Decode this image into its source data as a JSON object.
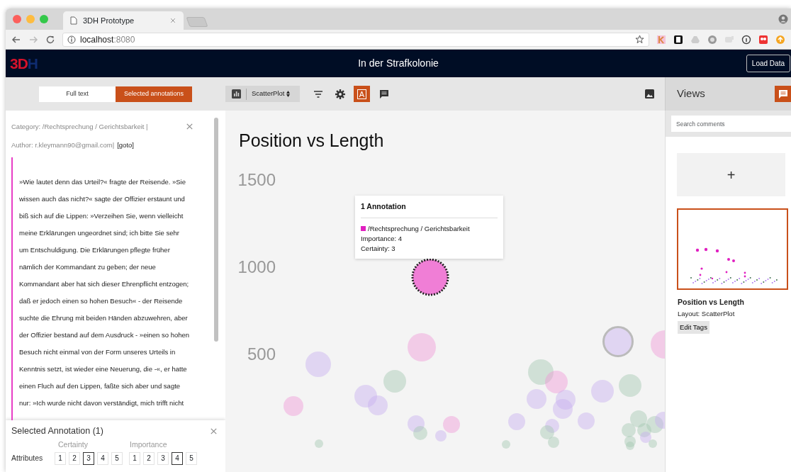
{
  "browser": {
    "tab_title": "3DH Prototype",
    "url_host": "localhost",
    "url_port": ":8080"
  },
  "app": {
    "logo_main": "3D",
    "logo_tail": "H",
    "title": "In der Strafkolonie",
    "load_button": "Load Data"
  },
  "text_modes": [
    {
      "label": "Full text",
      "selected": false
    },
    {
      "label": "Selected annotations",
      "selected": true
    }
  ],
  "toolbar": {
    "layout_select": "ScatterPlot",
    "annotation_toggle": {
      "label": "A",
      "on": true
    }
  },
  "annotation_detail": {
    "category": "Category: /Rechtsprechung / Gerichtsbarkeit |",
    "author": "Author: r.kleymann90@gmail.com|",
    "goto": "[goto]",
    "text_lines": [
      "»Wie lautet denn das Urteil?« fragte der Reisende. »Sie",
      "wissen auch das nicht?« sagte der Offizier erstaunt und",
      "biß sich auf die Lippen: »Verzeihen Sie, wenn vielleicht",
      "meine Erklärungen ungeordnet sind; ich bitte Sie sehr",
      "um Entschuldigung. Die Erklärungen pflegte früher",
      "nämlich der Kommandant zu geben; der neue",
      "Kommandant aber hat sich dieser Ehrenpflicht entzogen;",
      "daß er jedoch einen so hohen Besuch« - der Reisende",
      "suchte die Ehrung mit beiden Händen abzuwehren, aber",
      "der Offizier bestand auf dem Ausdruck - »einen so hohen",
      "Besuch nicht einmal von der Form unseres Urteils in",
      "Kenntnis setzt, ist wieder eine Neuerung, die -«, er hatte",
      "einen Fluch auf den Lippen, faßte sich aber und sagte",
      "nur: »Ich wurde nicht davon verständigt, mich trifft nicht"
    ]
  },
  "selected_annotation": {
    "title": "Selected Annotation (1)",
    "row_label": "Attributes",
    "groups": [
      {
        "name": "Certainty",
        "options": [
          {
            "label": "1",
            "selected": false
          },
          {
            "label": "2",
            "selected": false
          },
          {
            "label": "3",
            "selected": true
          },
          {
            "label": "4",
            "selected": false
          },
          {
            "label": "5",
            "selected": false
          }
        ]
      },
      {
        "name": "Importance",
        "options": [
          {
            "label": "1",
            "selected": false
          },
          {
            "label": "2",
            "selected": false
          },
          {
            "label": "3",
            "selected": false
          },
          {
            "label": "4",
            "selected": true
          },
          {
            "label": "5",
            "selected": false
          }
        ]
      }
    ]
  },
  "chart": {
    "title": "Position vs Length",
    "y_axis_labels": [
      "1500",
      "1000",
      "500"
    ],
    "tooltip": {
      "title": "1 Annotation",
      "category": "/Rechtsprechung / Gerichtsbarkeit",
      "color": "#e020c0",
      "importance": "Importance: 4",
      "certainty": "Certainty: 3"
    }
  },
  "views": {
    "title": "Views",
    "search": {
      "placeholder": "Search comments"
    },
    "add_label": "+",
    "items": [
      {
        "title": "Position vs Length",
        "layout": "Layout: ScatterPlot",
        "button": "Edit Tags",
        "selected": true
      }
    ]
  }
}
